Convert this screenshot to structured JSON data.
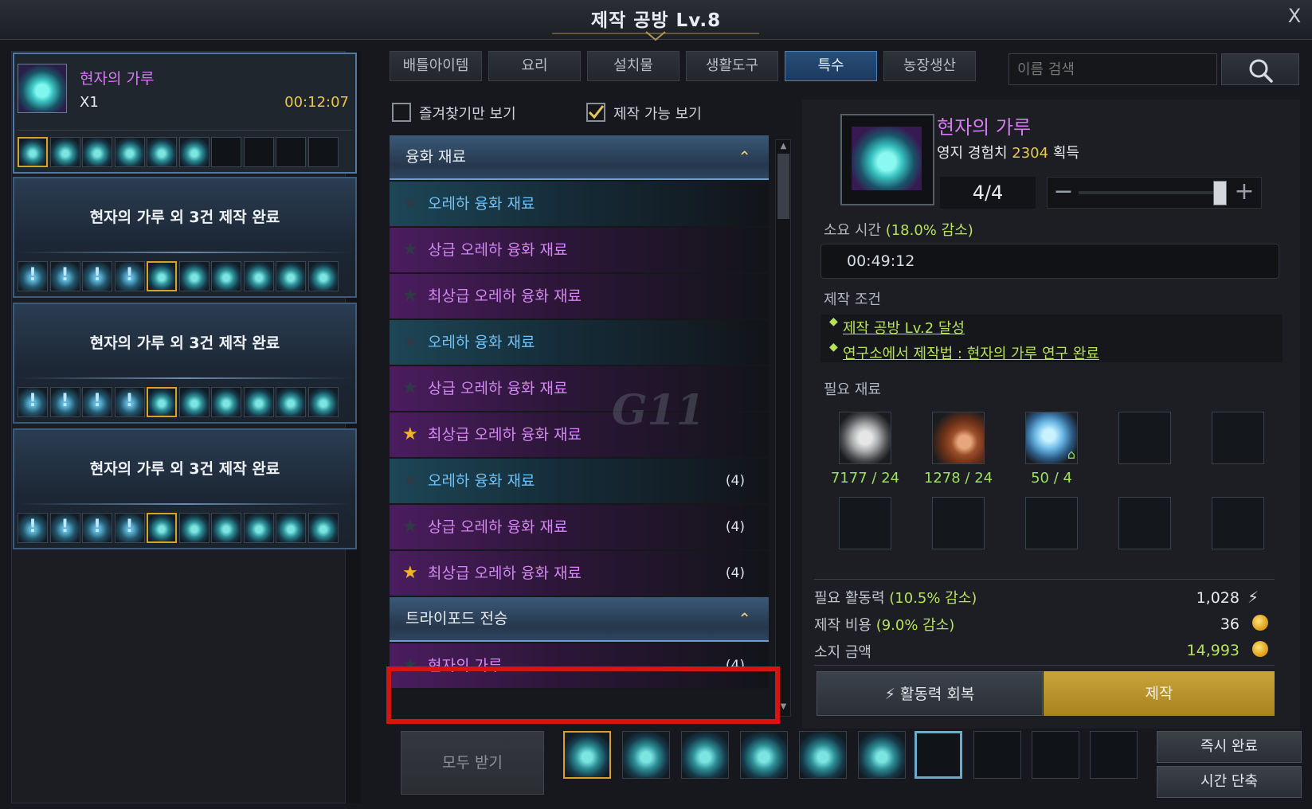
{
  "window": {
    "title": "제작 공방 Lv.8",
    "close_label": "X"
  },
  "queue": {
    "active": {
      "name": "현자의 가루",
      "qty": "X1",
      "timer": "00:12:07"
    },
    "completed_label": "현자의 가루 외 3건 제작 완료",
    "receive_all_label": "모두 받기"
  },
  "tabs": [
    "배틀아이템",
    "요리",
    "설치물",
    "생활도구",
    "특수",
    "농장생산"
  ],
  "active_tab": "특수",
  "search": {
    "placeholder": "이름 검색"
  },
  "filters": {
    "favorites_label": "즐겨찾기만 보기",
    "favorites_checked": false,
    "craftable_label": "제작 가능 보기",
    "craftable_checked": true
  },
  "categories": [
    {
      "name": "융화 재료",
      "items": [
        {
          "name": "오레하 융화 재료",
          "tier": "blue",
          "fav": false,
          "count": ""
        },
        {
          "name": "상급 오레하 융화 재료",
          "tier": "purple",
          "fav": false,
          "count": ""
        },
        {
          "name": "최상급 오레하 융화 재료",
          "tier": "purple",
          "fav": false,
          "count": ""
        },
        {
          "name": "오레하 융화 재료",
          "tier": "blue",
          "fav": false,
          "count": ""
        },
        {
          "name": "상급 오레하 융화 재료",
          "tier": "purple",
          "fav": false,
          "count": ""
        },
        {
          "name": "최상급 오레하 융화 재료",
          "tier": "purple",
          "fav": true,
          "count": ""
        },
        {
          "name": "오레하 융화 재료",
          "tier": "blue",
          "fav": false,
          "count": "(4)"
        },
        {
          "name": "상급 오레하 융화 재료",
          "tier": "purple",
          "fav": false,
          "count": "(4)"
        },
        {
          "name": "최상급 오레하 융화 재료",
          "tier": "purple",
          "fav": true,
          "count": "(4)"
        }
      ]
    },
    {
      "name": "트라이포드 전승",
      "items": [
        {
          "name": "현자의 가루",
          "tier": "purple",
          "fav": false,
          "count": "(4)"
        }
      ]
    }
  ],
  "detail": {
    "item_name": "현자의 가루",
    "exp_prefix": "영지 경험치",
    "exp_value": "2304",
    "exp_suffix": "획득",
    "quantity": "4/4",
    "time_label": "소요 시간",
    "time_reduction": "(18.0% 감소)",
    "time_value": "00:49:12",
    "conditions_label": "제작 조건",
    "conditions": [
      "제작 공방 Lv.2 달성",
      "연구소에서 제작법 : 현자의 가루 연구 완료"
    ],
    "materials_label": "필요 재료",
    "materials": [
      {
        "icon": "ore-icon",
        "qty": "7177 / 24"
      },
      {
        "icon": "timber-icon",
        "qty": "1278 / 24"
      },
      {
        "icon": "crystal-icon",
        "qty": "50 / 4"
      }
    ],
    "energy_label": "필요 활동력",
    "energy_reduction": "(10.5% 감소)",
    "energy_value": "1,028",
    "cost_label": "제작 비용",
    "cost_reduction": "(9.0% 감소)",
    "cost_value": "36",
    "owned_label": "소지 금액",
    "owned_value": "14,993",
    "recover_label": "활동력 회복",
    "craft_label": "제작"
  },
  "actions": {
    "instant_label": "즉시 완료",
    "shorten_label": "시간 단축"
  },
  "colors": {
    "accent_blue": "#4d7fb3",
    "craft_gold": "#c9a33a",
    "rare_purple": "#d387f0",
    "uncommon_blue": "#6fc0f5",
    "highlight_red": "#d51414"
  }
}
